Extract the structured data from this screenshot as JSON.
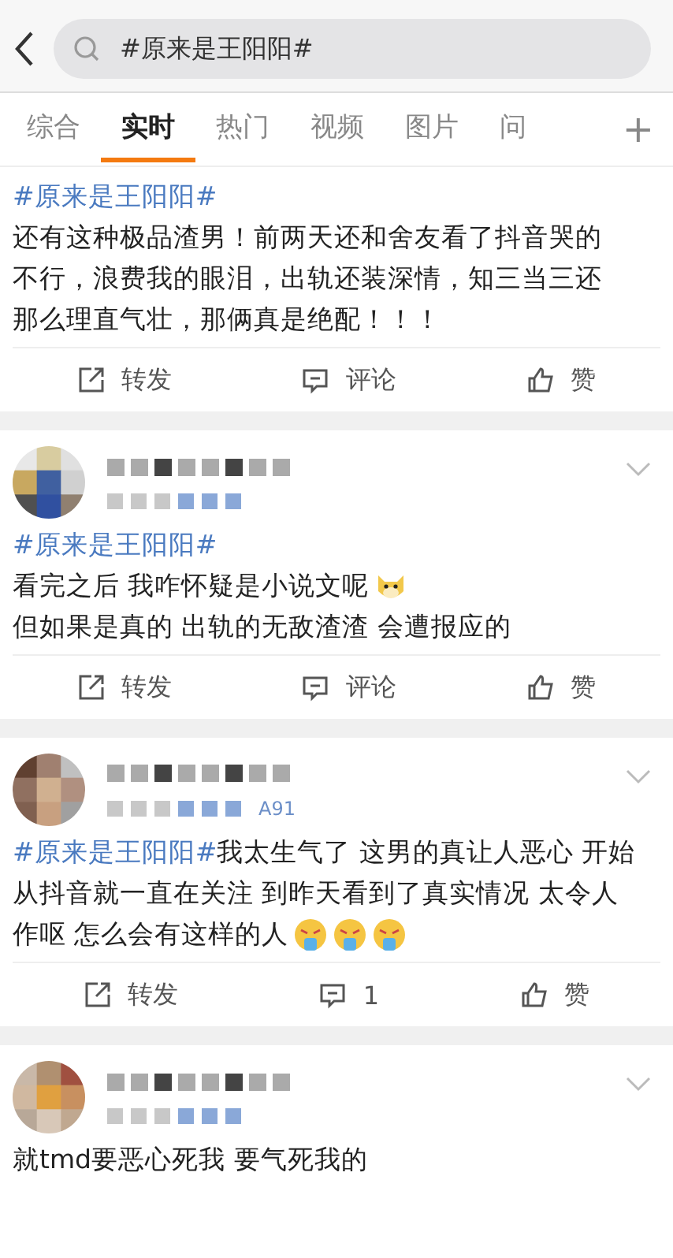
{
  "search": {
    "value": "#原来是王阳阳#"
  },
  "tabs": [
    {
      "label": "综合",
      "selected": false
    },
    {
      "label": "实时",
      "selected": true
    },
    {
      "label": "热门",
      "selected": false
    },
    {
      "label": "视频",
      "selected": false
    },
    {
      "label": "图片",
      "selected": false
    },
    {
      "label": "问",
      "selected": false
    }
  ],
  "add_tab": "+",
  "posts": [
    {
      "kind": "continued",
      "lines": [
        {
          "topic": "#原来是王阳阳#"
        },
        {
          "text": "还有这种极品渣男！前两天还和舍友看了抖音哭的"
        },
        {
          "text": "不行，浪费我的眼泪，出轨还装深情，知三当三还"
        },
        {
          "text": "那么理直气壮，那俩真是绝配！！！"
        }
      ],
      "actions": {
        "repost": "转发",
        "comment": "评论",
        "like": "赞"
      }
    },
    {
      "kind": "full",
      "lines": [
        {
          "topic": "#原来是王阳阳#"
        },
        {
          "text": "看完之后 我咋怀疑是小说文呢",
          "emojis": [
            {
              "kind": "doge"
            }
          ]
        },
        {
          "text": "但如果是真的 出轨的无敌渣渣 会遭报应的"
        }
      ],
      "actions": {
        "repost": "转发",
        "comment": "评论",
        "like": "赞"
      }
    },
    {
      "kind": "full",
      "source": "A91",
      "lines": [
        {
          "topic": "#原来是王阳阳#",
          "text": "我太生气了 这男的真让人恶心 开始"
        },
        {
          "text": "从抖音就一直在关注 到昨天看到了真实情况 太令人"
        },
        {
          "text": "作呕 怎么会有这样的人",
          "emojis": [
            {
              "kind": "vomit"
            },
            {
              "kind": "vomit"
            },
            {
              "kind": "vomit"
            }
          ]
        }
      ],
      "actions": {
        "repost": "转发",
        "comment": "1",
        "like": "赞"
      }
    },
    {
      "kind": "full",
      "lines": [
        {
          "text": "就tmd要恶心死我 要气死我的"
        }
      ]
    }
  ]
}
